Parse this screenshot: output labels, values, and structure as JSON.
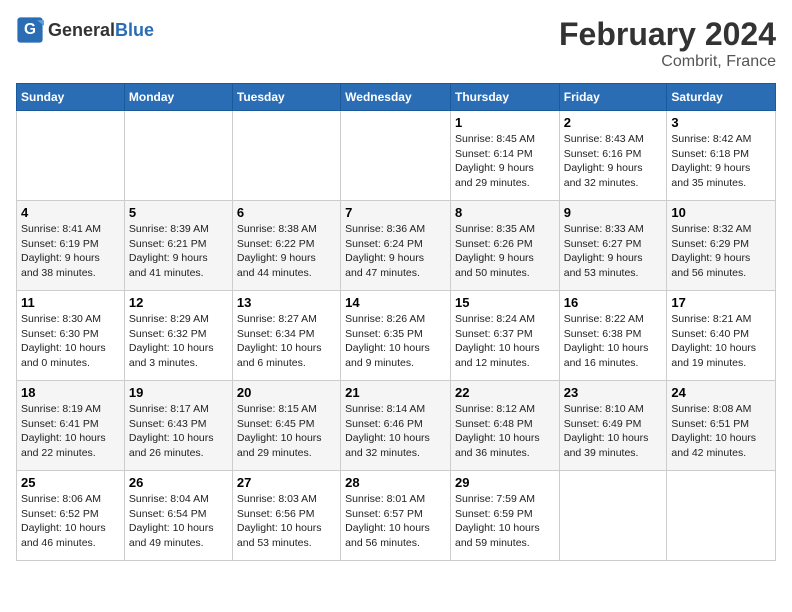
{
  "header": {
    "logo_general": "General",
    "logo_blue": "Blue",
    "title": "February 2024",
    "subtitle": "Combrit, France"
  },
  "weekdays": [
    "Sunday",
    "Monday",
    "Tuesday",
    "Wednesday",
    "Thursday",
    "Friday",
    "Saturday"
  ],
  "weeks": [
    [
      {
        "day": "",
        "info": ""
      },
      {
        "day": "",
        "info": ""
      },
      {
        "day": "",
        "info": ""
      },
      {
        "day": "",
        "info": ""
      },
      {
        "day": "1",
        "info": "Sunrise: 8:45 AM\nSunset: 6:14 PM\nDaylight: 9 hours\nand 29 minutes."
      },
      {
        "day": "2",
        "info": "Sunrise: 8:43 AM\nSunset: 6:16 PM\nDaylight: 9 hours\nand 32 minutes."
      },
      {
        "day": "3",
        "info": "Sunrise: 8:42 AM\nSunset: 6:18 PM\nDaylight: 9 hours\nand 35 minutes."
      }
    ],
    [
      {
        "day": "4",
        "info": "Sunrise: 8:41 AM\nSunset: 6:19 PM\nDaylight: 9 hours\nand 38 minutes."
      },
      {
        "day": "5",
        "info": "Sunrise: 8:39 AM\nSunset: 6:21 PM\nDaylight: 9 hours\nand 41 minutes."
      },
      {
        "day": "6",
        "info": "Sunrise: 8:38 AM\nSunset: 6:22 PM\nDaylight: 9 hours\nand 44 minutes."
      },
      {
        "day": "7",
        "info": "Sunrise: 8:36 AM\nSunset: 6:24 PM\nDaylight: 9 hours\nand 47 minutes."
      },
      {
        "day": "8",
        "info": "Sunrise: 8:35 AM\nSunset: 6:26 PM\nDaylight: 9 hours\nand 50 minutes."
      },
      {
        "day": "9",
        "info": "Sunrise: 8:33 AM\nSunset: 6:27 PM\nDaylight: 9 hours\nand 53 minutes."
      },
      {
        "day": "10",
        "info": "Sunrise: 8:32 AM\nSunset: 6:29 PM\nDaylight: 9 hours\nand 56 minutes."
      }
    ],
    [
      {
        "day": "11",
        "info": "Sunrise: 8:30 AM\nSunset: 6:30 PM\nDaylight: 10 hours\nand 0 minutes."
      },
      {
        "day": "12",
        "info": "Sunrise: 8:29 AM\nSunset: 6:32 PM\nDaylight: 10 hours\nand 3 minutes."
      },
      {
        "day": "13",
        "info": "Sunrise: 8:27 AM\nSunset: 6:34 PM\nDaylight: 10 hours\nand 6 minutes."
      },
      {
        "day": "14",
        "info": "Sunrise: 8:26 AM\nSunset: 6:35 PM\nDaylight: 10 hours\nand 9 minutes."
      },
      {
        "day": "15",
        "info": "Sunrise: 8:24 AM\nSunset: 6:37 PM\nDaylight: 10 hours\nand 12 minutes."
      },
      {
        "day": "16",
        "info": "Sunrise: 8:22 AM\nSunset: 6:38 PM\nDaylight: 10 hours\nand 16 minutes."
      },
      {
        "day": "17",
        "info": "Sunrise: 8:21 AM\nSunset: 6:40 PM\nDaylight: 10 hours\nand 19 minutes."
      }
    ],
    [
      {
        "day": "18",
        "info": "Sunrise: 8:19 AM\nSunset: 6:41 PM\nDaylight: 10 hours\nand 22 minutes."
      },
      {
        "day": "19",
        "info": "Sunrise: 8:17 AM\nSunset: 6:43 PM\nDaylight: 10 hours\nand 26 minutes."
      },
      {
        "day": "20",
        "info": "Sunrise: 8:15 AM\nSunset: 6:45 PM\nDaylight: 10 hours\nand 29 minutes."
      },
      {
        "day": "21",
        "info": "Sunrise: 8:14 AM\nSunset: 6:46 PM\nDaylight: 10 hours\nand 32 minutes."
      },
      {
        "day": "22",
        "info": "Sunrise: 8:12 AM\nSunset: 6:48 PM\nDaylight: 10 hours\nand 36 minutes."
      },
      {
        "day": "23",
        "info": "Sunrise: 8:10 AM\nSunset: 6:49 PM\nDaylight: 10 hours\nand 39 minutes."
      },
      {
        "day": "24",
        "info": "Sunrise: 8:08 AM\nSunset: 6:51 PM\nDaylight: 10 hours\nand 42 minutes."
      }
    ],
    [
      {
        "day": "25",
        "info": "Sunrise: 8:06 AM\nSunset: 6:52 PM\nDaylight: 10 hours\nand 46 minutes."
      },
      {
        "day": "26",
        "info": "Sunrise: 8:04 AM\nSunset: 6:54 PM\nDaylight: 10 hours\nand 49 minutes."
      },
      {
        "day": "27",
        "info": "Sunrise: 8:03 AM\nSunset: 6:56 PM\nDaylight: 10 hours\nand 53 minutes."
      },
      {
        "day": "28",
        "info": "Sunrise: 8:01 AM\nSunset: 6:57 PM\nDaylight: 10 hours\nand 56 minutes."
      },
      {
        "day": "29",
        "info": "Sunrise: 7:59 AM\nSunset: 6:59 PM\nDaylight: 10 hours\nand 59 minutes."
      },
      {
        "day": "",
        "info": ""
      },
      {
        "day": "",
        "info": ""
      }
    ]
  ]
}
